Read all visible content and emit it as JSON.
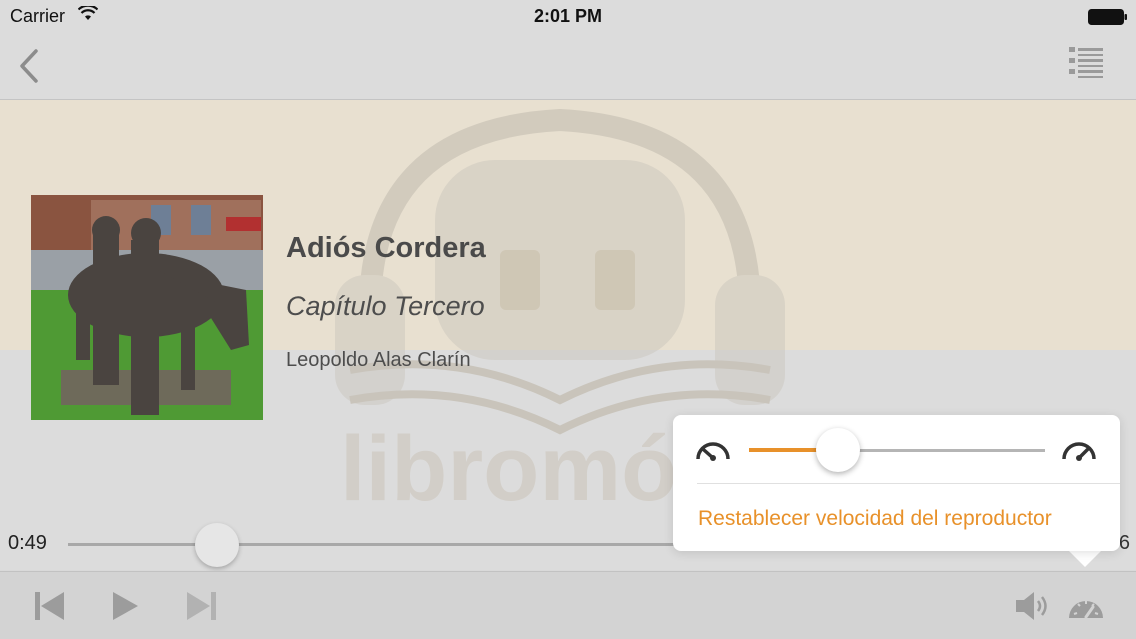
{
  "status_bar": {
    "carrier": "Carrier",
    "time": "2:01 PM"
  },
  "nav": {
    "back_icon": "chevron-left-icon",
    "list_icon": "list-icon"
  },
  "watermark": {
    "brand": "libromó"
  },
  "book": {
    "title": "Adiós Cordera",
    "chapter": "Capítulo Tercero",
    "author": "Leopoldo Alas Clarín"
  },
  "playback": {
    "elapsed": "0:49",
    "remaining_partial": "6",
    "progress_fraction": 0.24
  },
  "speed_popover": {
    "slow_icon": "speedometer-slow-icon",
    "fast_icon": "speedometer-fast-icon",
    "speed_fraction": 0.3,
    "reset_label": "Restablecer velocidad del reproductor"
  },
  "controls": {
    "icons": [
      "skip-back-icon",
      "play-icon",
      "skip-forward-icon",
      "volume-icon",
      "speedometer-icon"
    ]
  },
  "colors": {
    "accent": "#e8912a",
    "hero_bg": "#e8e0d0",
    "bar_bg": "#dcdcdc"
  }
}
